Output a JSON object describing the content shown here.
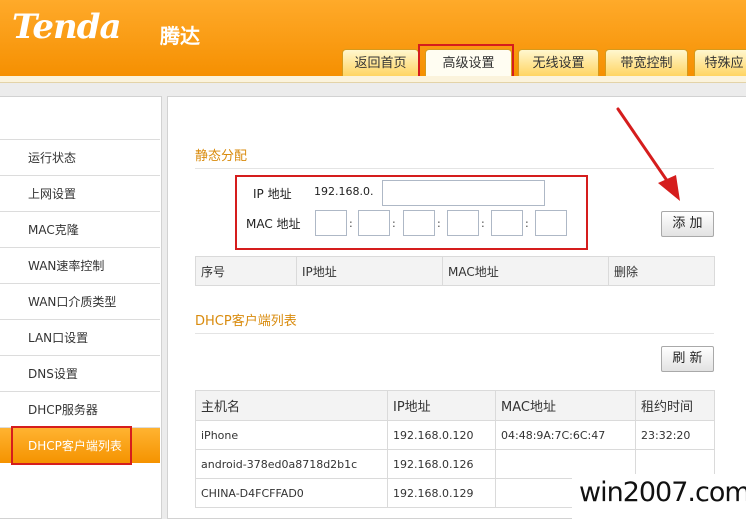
{
  "brand": {
    "logo": "Tenda",
    "name_cn": "腾达"
  },
  "nav": {
    "tabs": [
      {
        "label": "返回首页"
      },
      {
        "label": "高级设置",
        "active": true
      },
      {
        "label": "无线设置"
      },
      {
        "label": "带宽控制"
      },
      {
        "label": "特殊应"
      }
    ]
  },
  "sidebar": {
    "items": [
      {
        "label": "运行状态"
      },
      {
        "label": "上网设置"
      },
      {
        "label": "MAC克隆"
      },
      {
        "label": "WAN速率控制"
      },
      {
        "label": "WAN口介质类型"
      },
      {
        "label": "LAN口设置"
      },
      {
        "label": "DNS设置"
      },
      {
        "label": "DHCP服务器"
      },
      {
        "label": "DHCP客户端列表",
        "active": true
      }
    ]
  },
  "static": {
    "title": "静态分配",
    "ip_label": "IP 地址",
    "ip_prefix": "192.168.0.",
    "ip_value": "",
    "mac_label": "MAC 地址",
    "mac_separator": ":",
    "mac_values": [
      "",
      "",
      "",
      "",
      "",
      ""
    ],
    "add_button": "添 加",
    "columns": [
      "序号",
      "IP地址",
      "MAC地址",
      "删除"
    ]
  },
  "dhcp": {
    "title": "DHCP客户端列表",
    "refresh_button": "刷 新",
    "columns": [
      "主机名",
      "IP地址",
      "MAC地址",
      "租约时间"
    ],
    "rows": [
      {
        "host": "iPhone",
        "ip": "192.168.0.120",
        "mac": "04:48:9A:7C:6C:47",
        "lease": "23:32:20"
      },
      {
        "host": "android-378ed0a8718d2b1c",
        "ip": "192.168.0.126",
        "mac": "",
        "lease": ""
      },
      {
        "host": "CHINA-D4FCFFAD0",
        "ip": "192.168.0.129",
        "mac": "",
        "lease": ""
      }
    ]
  },
  "watermark": "win2007.com",
  "colors": {
    "header_orange": "#f7961c",
    "highlight_red": "#d51d1d",
    "section_title": "#d98b0d"
  }
}
